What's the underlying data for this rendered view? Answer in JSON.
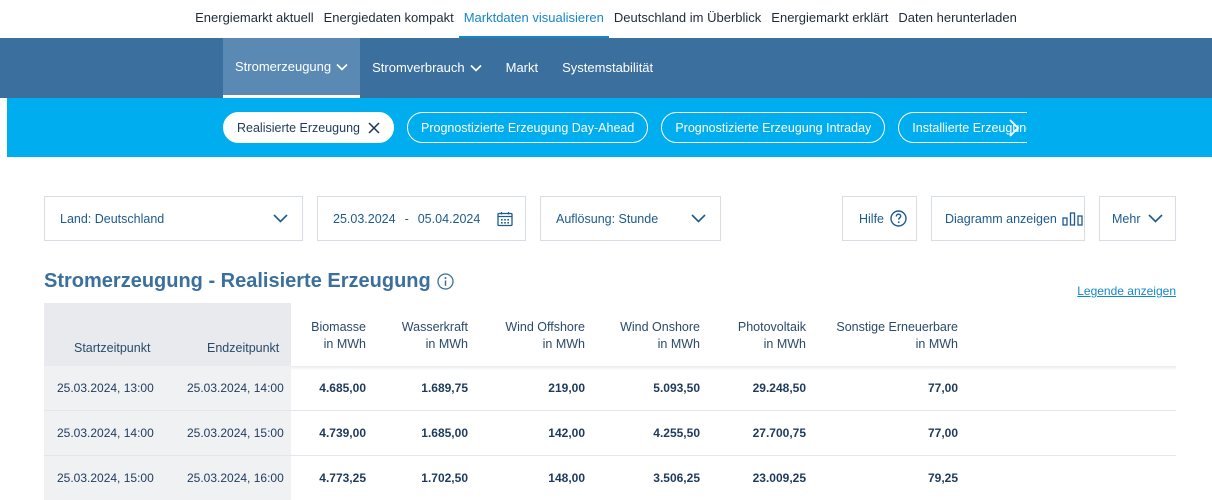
{
  "top_nav": [
    {
      "label": "Energiemarkt aktuell",
      "active": false
    },
    {
      "label": "Energiedaten kompakt",
      "active": false
    },
    {
      "label": "Marktdaten visualisieren",
      "active": true
    },
    {
      "label": "Deutschland im Überblick",
      "active": false
    },
    {
      "label": "Energiemarkt erklärt",
      "active": false
    },
    {
      "label": "Daten herunterladen",
      "active": false
    }
  ],
  "main_tabs": [
    {
      "label": "Stromerzeugung",
      "dropdown": true,
      "active": true
    },
    {
      "label": "Stromverbrauch",
      "dropdown": true,
      "active": false
    },
    {
      "label": "Markt",
      "dropdown": false,
      "active": false
    },
    {
      "label": "Systemstabilität",
      "dropdown": false,
      "active": false
    }
  ],
  "sub_pills": [
    {
      "label": "Realisierte Erzeugung",
      "active": true
    },
    {
      "label": "Prognostizierte Erzeugung Day-Ahead",
      "active": false
    },
    {
      "label": "Prognostizierte Erzeugung Intraday",
      "active": false
    },
    {
      "label": "Installierte Erzeugung",
      "active": false
    }
  ],
  "filters": {
    "land": "Land: Deutschland",
    "date_from": "25.03.2024",
    "date_sep": "-",
    "date_to": "05.04.2024",
    "resolution": "Auflösung: Stunde",
    "help": "Hilfe",
    "diagram": "Diagramm anzeigen",
    "more": "Mehr"
  },
  "heading": "Stromerzeugung - Realisierte Erzeugung",
  "legend_link": "Legende anzeigen",
  "table": {
    "columns": [
      {
        "line1": "Startzeitpunkt",
        "line2": ""
      },
      {
        "line1": "Endzeitpunkt",
        "line2": ""
      },
      {
        "line1": "Biomasse",
        "line2": "in MWh"
      },
      {
        "line1": "Wasserkraft",
        "line2": "in MWh"
      },
      {
        "line1": "Wind Offshore",
        "line2": "in MWh"
      },
      {
        "line1": "Wind Onshore",
        "line2": "in MWh"
      },
      {
        "line1": "Photovoltaik",
        "line2": "in MWh"
      },
      {
        "line1": "Sonstige Erneuerbare",
        "line2": "in MWh"
      }
    ],
    "rows": [
      [
        "25.03.2024, 13:00",
        "25.03.2024, 14:00",
        "4.685,00",
        "1.689,75",
        "219,00",
        "5.093,50",
        "29.248,50",
        "77,00"
      ],
      [
        "25.03.2024, 14:00",
        "25.03.2024, 15:00",
        "4.739,00",
        "1.685,00",
        "142,00",
        "4.255,50",
        "27.700,75",
        "77,00"
      ],
      [
        "25.03.2024, 15:00",
        "25.03.2024, 16:00",
        "4.773,25",
        "1.702,50",
        "148,00",
        "3.506,25",
        "23.009,25",
        "79,25"
      ]
    ]
  },
  "colors": {
    "top_active": "#1587c9",
    "main_bar": "#3a6f9e",
    "sub_bar": "#00adef",
    "heading": "#3a6f9e"
  }
}
